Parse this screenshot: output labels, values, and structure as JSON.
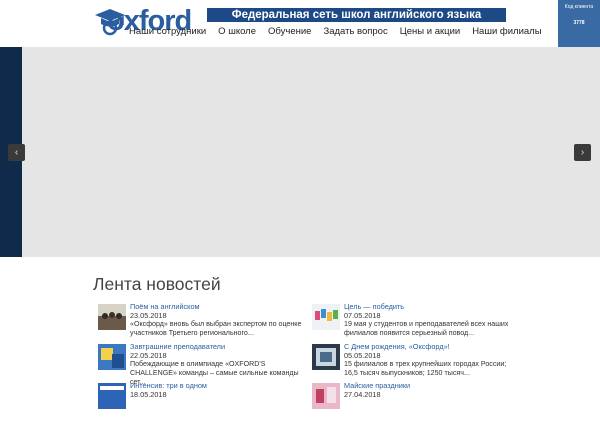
{
  "header": {
    "logo_text": "oxford",
    "banner": "Федеральная сеть школ английского языка",
    "nav": [
      "Наши сотрудники",
      "О школе",
      "Обучение",
      "Задать вопрос",
      "Цены и акции",
      "Наши филиалы"
    ],
    "client_code_label": "Код клиента",
    "client_code_value": "3778"
  },
  "slider": {
    "prev": "‹",
    "next": "›"
  },
  "news": {
    "title": "Лента новостей",
    "items": [
      {
        "title": "Поём на английском",
        "date": "23.05.2018",
        "desc": "«Оксфорд» вновь был выбран экспертом по оценке участников Третьего регионального..."
      },
      {
        "title": "Цель — победить",
        "date": "07.05.2018",
        "desc": "19 мая у студентов и преподавателей всех наших филиалов появится серьезный повод..."
      },
      {
        "title": "Завтрашние преподаватели",
        "date": "22.05.2018",
        "desc": "Побеждающие в олимпиаде «OXFORD'S CHALLENGE» команды – самые сильные команды сет..."
      },
      {
        "title": "С Днем рождения, «Оксфорд»!",
        "date": "05.05.2018",
        "desc": "15 филиалов в трех крупнейших городах России; 16,5 тысяч выпускников; 1250 тысяч..."
      },
      {
        "title": "Интенсив: три в одном",
        "date": "18.05.2018",
        "desc": ""
      },
      {
        "title": "Майские праздники",
        "date": "27.04.2018",
        "desc": ""
      }
    ]
  }
}
